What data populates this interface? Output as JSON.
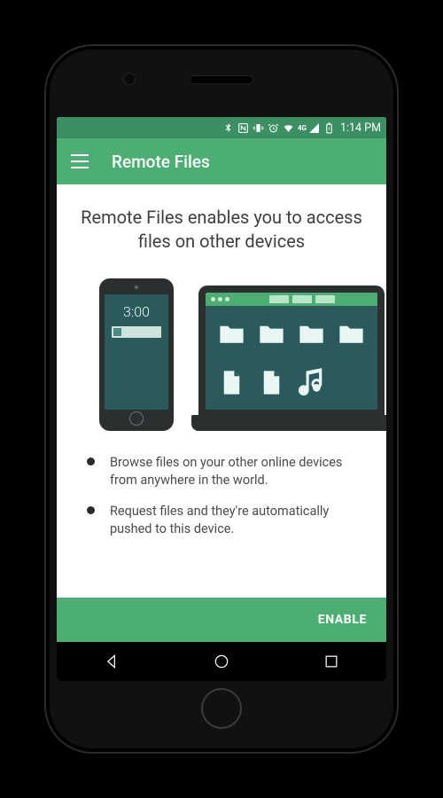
{
  "statusbar": {
    "network_label": "4G",
    "clock": "1:14 PM"
  },
  "appbar": {
    "title": "Remote Files"
  },
  "content": {
    "headline": "Remote Files enables you to access files on other devices",
    "illustration": {
      "phone_clock": "3:00"
    },
    "bullets": [
      "Browse files on your other online devices from anywhere in the world.",
      "Request files and they're automatically pushed to this device."
    ]
  },
  "bottombar": {
    "enable_label": "ENABLE"
  },
  "icons": {
    "menu": "menu-icon",
    "bluetooth": "bluetooth-icon",
    "nfc": "nfc-icon",
    "vibrate": "vibrate-icon",
    "alarm": "alarm-icon",
    "wifi": "wifi-icon",
    "signal": "signal-icon",
    "battery": "battery-icon"
  }
}
